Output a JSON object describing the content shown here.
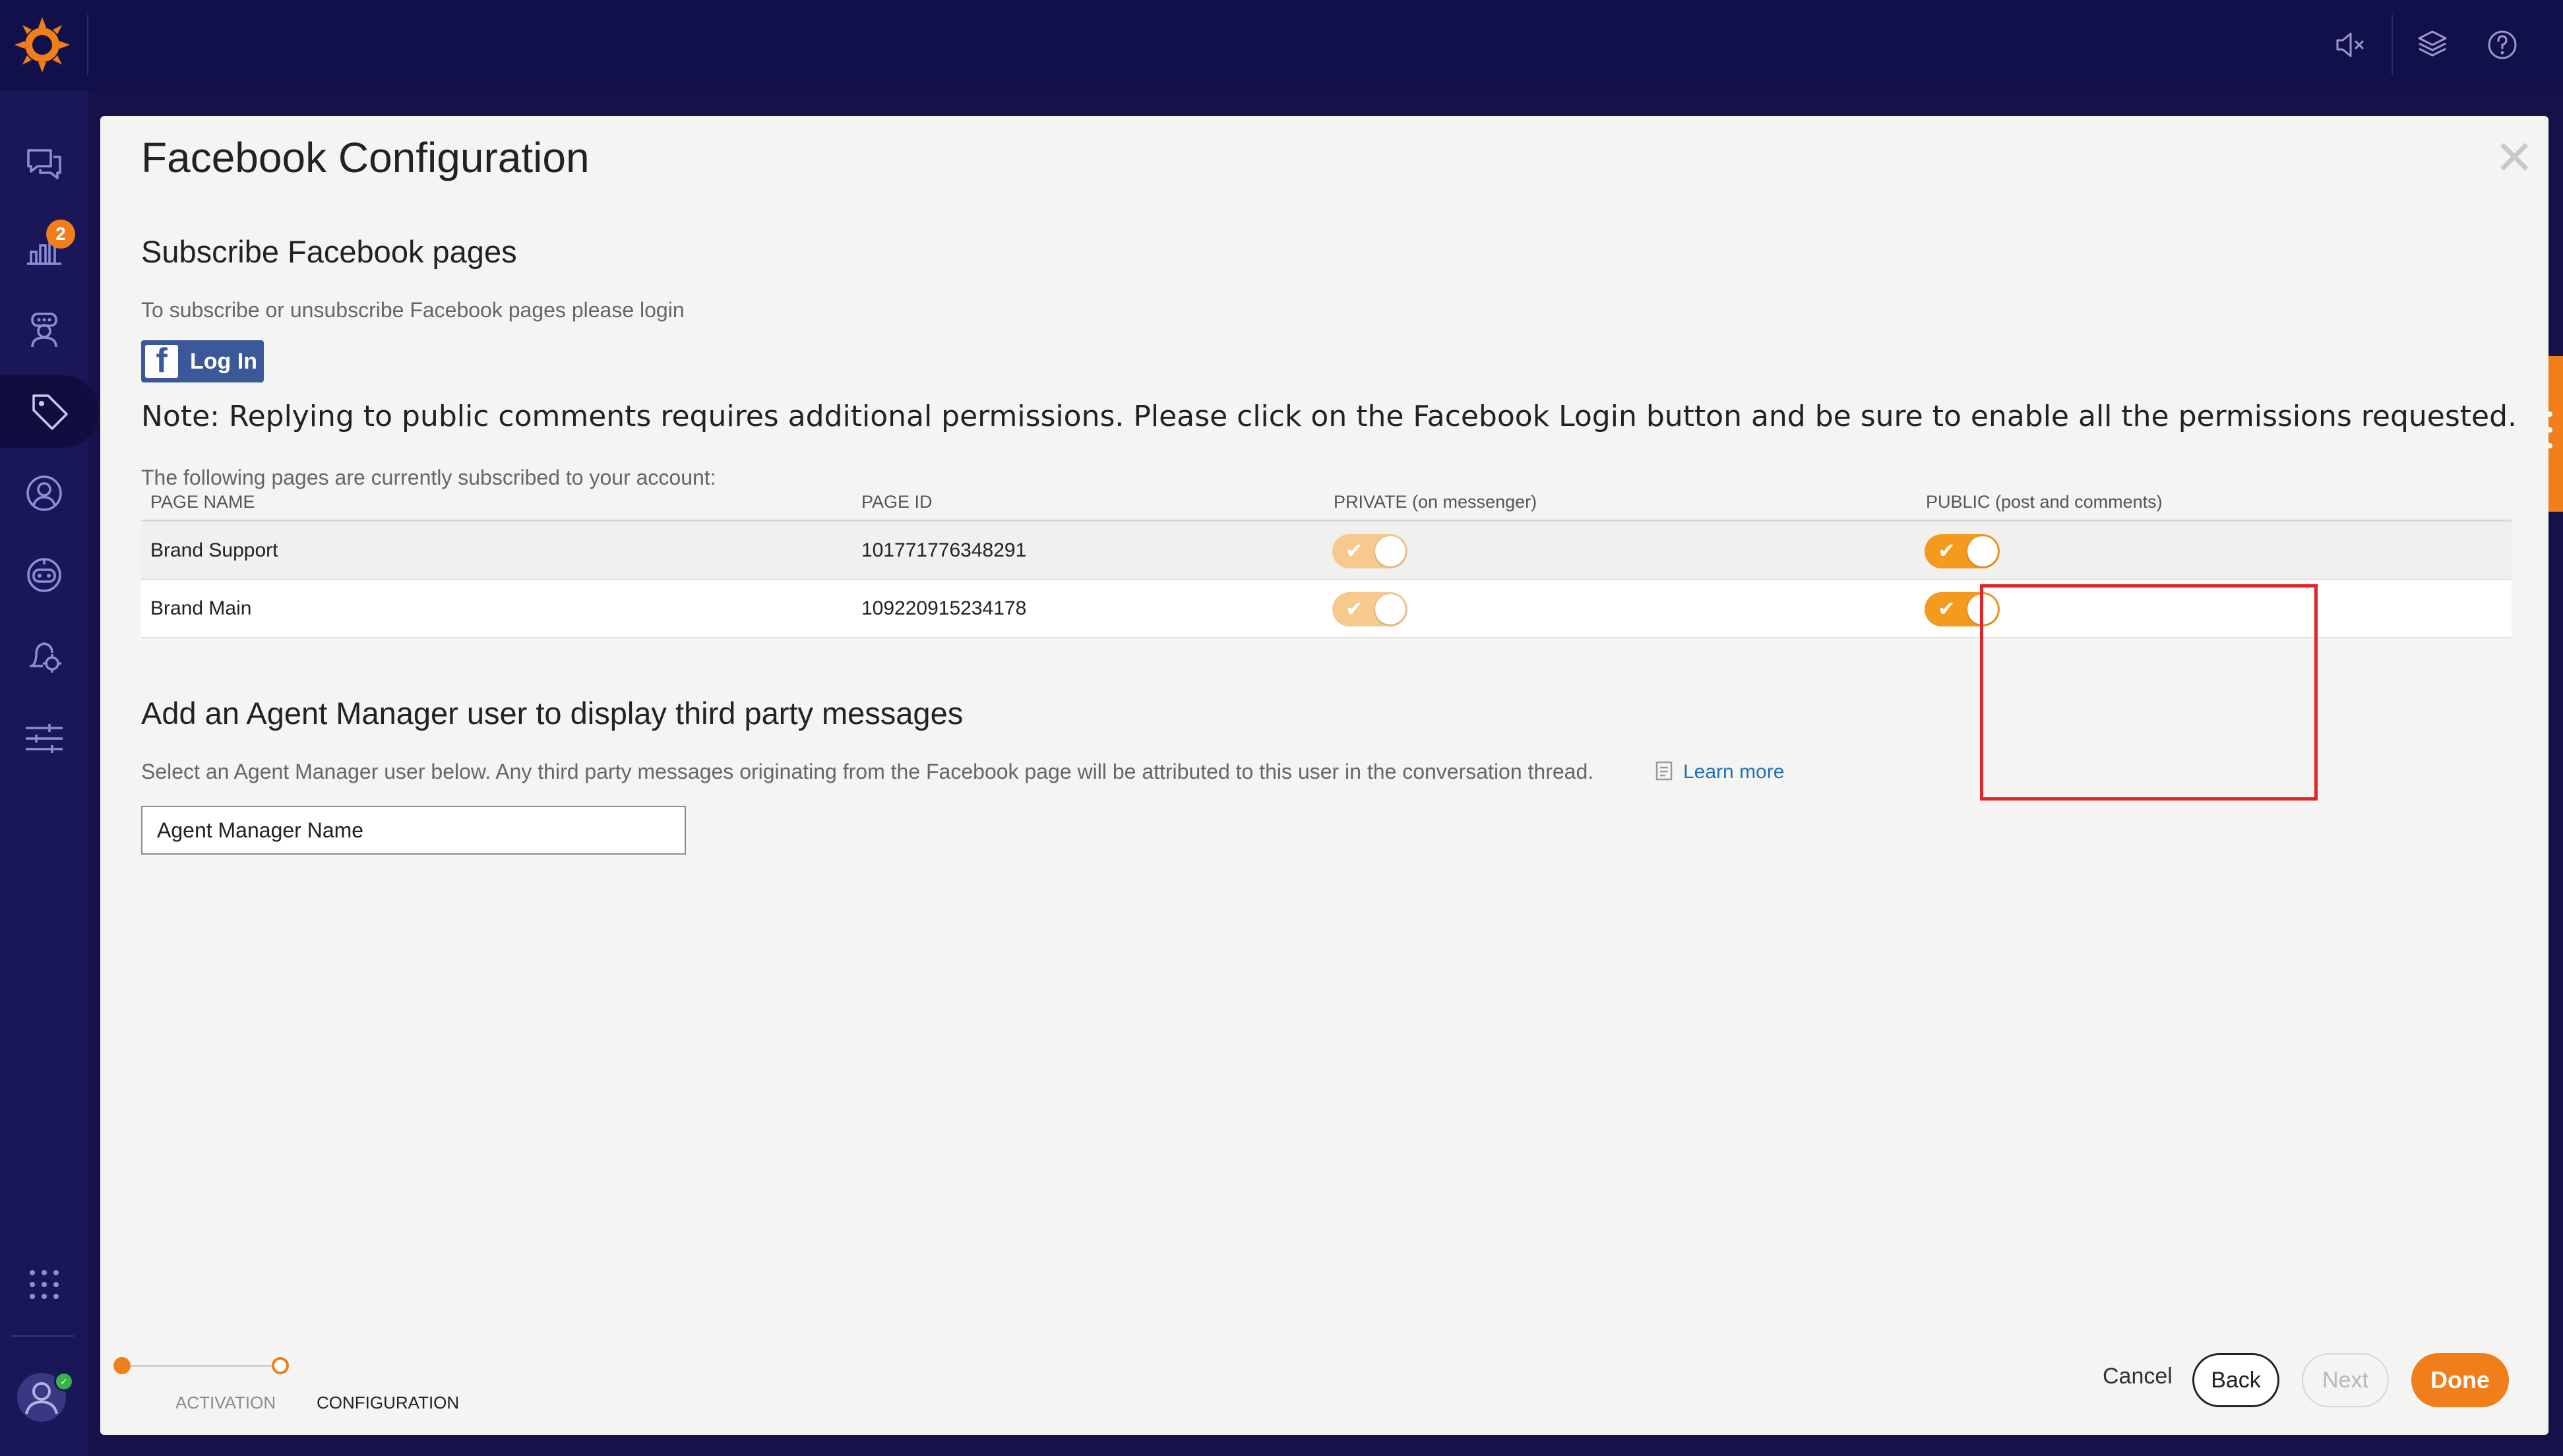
{
  "topbar": {
    "icons": [
      "app-logo-sun-icon",
      "speaker-muted-icon",
      "layers-icon",
      "help-circle-icon"
    ]
  },
  "sidebar": {
    "items": [
      {
        "name": "conversations",
        "icon": "chat-bubbles-icon",
        "badge": "2"
      },
      {
        "name": "analytics",
        "icon": "bar-chart-icon"
      },
      {
        "name": "agents",
        "icon": "agent-headset-icon"
      },
      {
        "name": "campaigns",
        "icon": "tag-icon",
        "active": true
      },
      {
        "name": "users",
        "icon": "user-circle-icon"
      },
      {
        "name": "bots",
        "icon": "robot-icon"
      },
      {
        "name": "automation",
        "icon": "bell-gear-icon"
      },
      {
        "name": "settings",
        "icon": "sliders-icon"
      },
      {
        "name": "apps",
        "icon": "grid-dots-icon"
      },
      {
        "name": "profile",
        "icon": "avatar-icon"
      }
    ]
  },
  "modal": {
    "title": "Facebook Configuration",
    "subscribe_title": "Subscribe Facebook pages",
    "subscribe_help": "To subscribe or unsubscribe Facebook pages please login",
    "fb_login_label": "Log In",
    "note": "Note: Replying to public comments requires additional permissions. Please click on the Facebook Login button and be sure to enable all the permissions requested.",
    "pages_intro": "The following pages are currently subscribed to your account:",
    "table": {
      "headers": [
        "PAGE NAME",
        "PAGE ID",
        "PRIVATE (on messenger)",
        "PUBLIC (post and comments)"
      ],
      "rows": [
        {
          "page_name": "Brand Support",
          "page_id": "101771776348291",
          "private_enabled": true,
          "public_enabled": true
        },
        {
          "page_name": "Brand Main",
          "page_id": "109220915234178",
          "private_enabled": true,
          "public_enabled": true
        }
      ]
    },
    "agent_title": "Add an Agent Manager user to display third party messages",
    "agent_help": "Select an Agent Manager user below. Any third party messages originating from the Facebook page will be attributed to this user in the conversation thread.",
    "learn_more": "Learn more",
    "agent_input_value": "Agent Manager Name"
  },
  "stepper": {
    "steps": [
      {
        "label": "ACTIVATION",
        "state": "done"
      },
      {
        "label": "CONFIGURATION",
        "state": "current"
      }
    ]
  },
  "footer": {
    "cancel": "Cancel",
    "back": "Back",
    "next": "Next",
    "done": "Done"
  },
  "colors": {
    "accent": "#f07e1b",
    "nav_bg": "#1a1759",
    "topbar_bg": "#12104a",
    "facebook_blue": "#3b5998",
    "highlight_red": "#e0252b",
    "link_blue": "#1f6fb6"
  }
}
